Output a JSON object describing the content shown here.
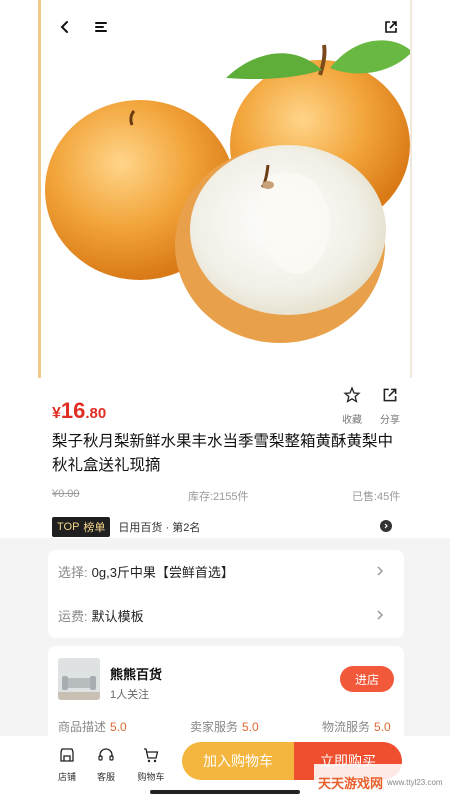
{
  "colors": {
    "accent": "#e02e24",
    "cart_button": "#f4b63f",
    "buy_button": "#ef4f2e",
    "enter_button": "#f2583a"
  },
  "nav": {
    "back_icon": "back-arrow-icon",
    "menu_icon": "menu-icon",
    "share_icon": "share-icon"
  },
  "product": {
    "price_currency": "¥",
    "price_int": "16",
    "price_dec": ".80",
    "title": "梨子秋月梨新鲜水果丰水当季雪梨整箱黄酥黄梨中秋礼盒送礼现摘",
    "original_price": "¥0.00",
    "stock": "库存:2155件",
    "sold": "已售:45件"
  },
  "actions": {
    "favorite_label": "收藏",
    "share_label": "分享"
  },
  "ranking": {
    "top_label": "TOP",
    "list_label": "榜单",
    "text": "日用百货 · 第2名"
  },
  "options": {
    "select_key": "选择:",
    "select_value": "0g,3斤中果【尝鲜首选】",
    "shipping_key": "运费:",
    "shipping_value": "默认模板"
  },
  "shop": {
    "name": "熊熊百货",
    "followers": "1人关注",
    "enter_label": "进店",
    "scores": [
      {
        "label": "商品描述",
        "value": "5.0"
      },
      {
        "label": "卖家服务",
        "value": "5.0"
      },
      {
        "label": "物流服务",
        "value": "5.0"
      }
    ]
  },
  "bottom": {
    "tabs": [
      {
        "label": "店铺",
        "icon": "store-icon"
      },
      {
        "label": "客服",
        "icon": "headset-icon"
      },
      {
        "label": "购物车",
        "icon": "cart-icon"
      }
    ],
    "add_cart_label": "加入购物车",
    "buy_label": "立即购买"
  },
  "watermark": {
    "text": "天天游戏网",
    "url": "www.ttyl23.com"
  }
}
